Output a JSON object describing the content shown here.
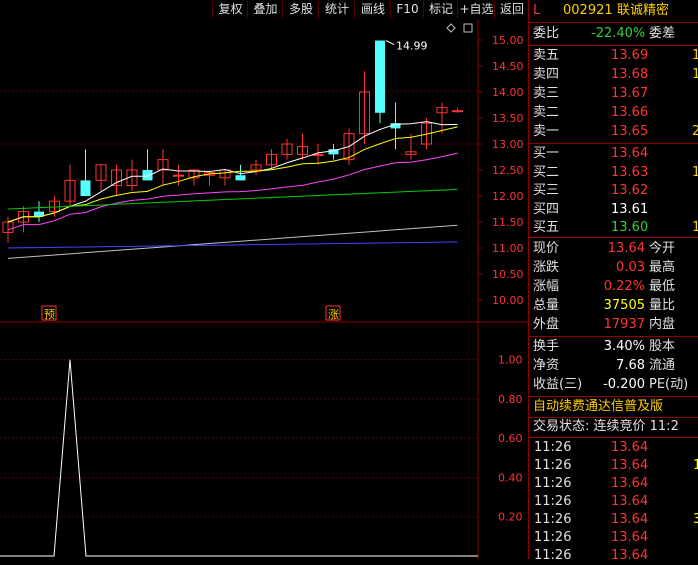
{
  "toolbar": {
    "buttons": [
      "复权",
      "叠加",
      "多股",
      "统计",
      "画线",
      "F10",
      "标记",
      "+自选",
      "返回"
    ]
  },
  "chart": {
    "peak_label": "14.99",
    "price_axis": [
      "15.00",
      "14.50",
      "14.00",
      "13.50",
      "13.00",
      "12.50",
      "12.00",
      "11.50",
      "11.00",
      "10.50",
      "10.00"
    ],
    "indicator_axis": [
      "1.00",
      "0.80",
      "0.60",
      "0.40",
      "0.20"
    ],
    "markers": {
      "yu": "预",
      "zhang": "涨"
    },
    "colors": {
      "up": "#ff3333",
      "down": "#54ffff",
      "ma5": "#ffffff",
      "ma10": "#ffff00",
      "ma20": "#ff44ff",
      "ma30": "#00cc00",
      "ma60": "#c0c0c0",
      "ma120": "#4444ff"
    }
  },
  "chart_data": {
    "type": "candlestick",
    "x": [
      1,
      2,
      3,
      4,
      5,
      6,
      7,
      8,
      9,
      10,
      11,
      12,
      13,
      14,
      15,
      16,
      17,
      18,
      19,
      20,
      21,
      22,
      23,
      24,
      25,
      26,
      27,
      28,
      29,
      30
    ],
    "open": [
      11.3,
      11.5,
      11.7,
      11.7,
      11.9,
      12.3,
      12.3,
      12.2,
      12.2,
      12.5,
      12.5,
      12.4,
      12.35,
      12.4,
      12.35,
      12.4,
      12.5,
      12.6,
      12.8,
      12.8,
      12.8,
      12.9,
      12.7,
      13.2,
      14.99,
      13.4,
      12.8,
      13.0,
      13.6,
      13.64
    ],
    "high": [
      11.6,
      11.8,
      11.9,
      12.0,
      12.6,
      12.9,
      12.6,
      12.6,
      12.7,
      12.9,
      12.9,
      12.6,
      12.5,
      12.5,
      12.5,
      12.6,
      12.7,
      12.9,
      13.1,
      13.2,
      13.0,
      13.0,
      13.3,
      14.4,
      14.99,
      13.8,
      13.2,
      13.5,
      13.8,
      13.7
    ],
    "low": [
      11.1,
      11.3,
      11.5,
      11.6,
      11.8,
      12.0,
      12.1,
      12.0,
      12.1,
      12.3,
      12.2,
      12.2,
      12.2,
      12.2,
      12.2,
      12.3,
      12.4,
      12.5,
      12.7,
      12.7,
      12.6,
      12.7,
      12.6,
      13.0,
      13.4,
      12.9,
      12.7,
      12.9,
      13.2,
      13.6
    ],
    "close": [
      11.5,
      11.7,
      11.6,
      11.9,
      12.3,
      12.0,
      12.6,
      12.5,
      12.5,
      12.3,
      12.7,
      12.4,
      12.5,
      12.45,
      12.5,
      12.3,
      12.6,
      12.8,
      13.0,
      12.95,
      12.8,
      12.8,
      13.2,
      14.0,
      13.6,
      13.3,
      12.85,
      13.4,
      13.7,
      13.64
    ],
    "indicator": {
      "ylim": [
        0,
        1.1
      ],
      "spike_index": 4,
      "spike_value": 1.0
    },
    "ylim": [
      9.8,
      15.3
    ]
  },
  "panel": {
    "code": "002921",
    "name": "联诚精密",
    "prefix": "L",
    "weibi_label": "委比",
    "weibi_value": "-22.40%",
    "weicha_label": "委差",
    "sell": [
      {
        "label": "卖五",
        "price": "13.69",
        "vol": "1"
      },
      {
        "label": "卖四",
        "price": "13.68",
        "vol": "1("
      },
      {
        "label": "卖三",
        "price": "13.67",
        "vol": ""
      },
      {
        "label": "卖二",
        "price": "13.66",
        "vol": ""
      },
      {
        "label": "卖一",
        "price": "13.65",
        "vol": "2"
      }
    ],
    "buy": [
      {
        "label": "买一",
        "price": "13.64",
        "vol": ""
      },
      {
        "label": "买二",
        "price": "13.63",
        "vol": "1"
      },
      {
        "label": "买三",
        "price": "13.62",
        "vol": ""
      },
      {
        "label": "买四",
        "price": "13.61",
        "vol": ""
      },
      {
        "label": "买五",
        "price": "13.60",
        "vol": "1"
      }
    ],
    "stats": [
      {
        "label": "现价",
        "value": "13.64",
        "label2": "今开"
      },
      {
        "label": "涨跌",
        "value": "0.03",
        "label2": "最高"
      },
      {
        "label": "涨幅",
        "value": "0.22%",
        "label2": "最低"
      },
      {
        "label": "总量",
        "value": "37505",
        "label2": "量比"
      },
      {
        "label": "外盘",
        "value": "17937",
        "label2": "内盘"
      }
    ],
    "stats2": [
      {
        "label": "换手",
        "value": "3.40%",
        "label2": "股本"
      },
      {
        "label": "净资",
        "value": "7.68",
        "label2": "流通"
      },
      {
        "label": "收益(三)",
        "value": "-0.200",
        "label2": "PE(动)"
      }
    ],
    "notice": "自动续费通达信普及版",
    "trade_status": "交易状态: 连续竞价 11:2",
    "ticks": [
      {
        "time": "11:26",
        "price": "13.64",
        "vol": ""
      },
      {
        "time": "11:26",
        "price": "13.64",
        "vol": "1"
      },
      {
        "time": "11:26",
        "price": "13.64",
        "vol": ""
      },
      {
        "time": "11:26",
        "price": "13.64",
        "vol": ""
      },
      {
        "time": "11:26",
        "price": "13.64",
        "vol": "3"
      },
      {
        "time": "11:26",
        "price": "13.64",
        "vol": ""
      },
      {
        "time": "11:26",
        "price": "13.64",
        "vol": ""
      }
    ]
  }
}
